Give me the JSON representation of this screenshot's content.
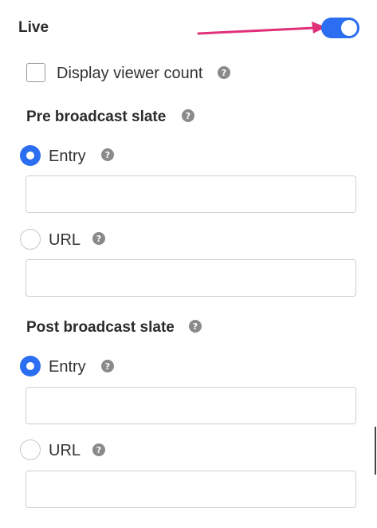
{
  "live": {
    "title": "Live",
    "toggle_on": true,
    "accent_color": "#2b6ef2",
    "arrow_color": "#e0307a"
  },
  "viewer_count": {
    "label": "Display viewer count",
    "checked": false
  },
  "pre_broadcast": {
    "title": "Pre broadcast slate",
    "options": [
      {
        "label": "Entry",
        "selected": true,
        "value": ""
      },
      {
        "label": "URL",
        "selected": false,
        "value": ""
      }
    ]
  },
  "post_broadcast": {
    "title": "Post broadcast slate",
    "options": [
      {
        "label": "Entry",
        "selected": true,
        "value": ""
      },
      {
        "label": "URL",
        "selected": false,
        "value": ""
      }
    ]
  },
  "help_glyph": "?",
  "icons": {
    "help": "question-circle-icon",
    "arrow": "annotation-arrow-icon"
  }
}
